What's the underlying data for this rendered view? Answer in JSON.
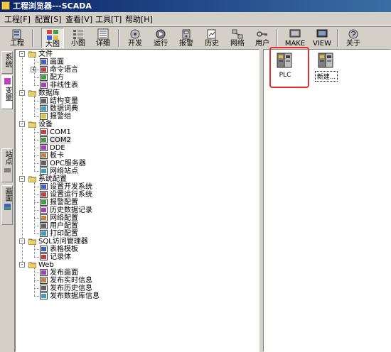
{
  "window": {
    "title": "工程浏览器---SCADA"
  },
  "menu": [
    "工程[F]",
    "配置[S]",
    "查看[V]",
    "工具[T]",
    "帮助[H]"
  ],
  "toolbar": {
    "buttons": [
      {
        "label": "工程",
        "icon": "project-icon"
      },
      {
        "label": "大图",
        "icon": "large-icons-icon",
        "pressed": true
      },
      {
        "label": "小图",
        "icon": "small-icons-icon"
      },
      {
        "label": "详细",
        "icon": "details-icon"
      },
      {
        "label": "开发",
        "icon": "develop-icon"
      },
      {
        "label": "运行",
        "icon": "run-icon"
      },
      {
        "label": "报警",
        "icon": "alarm-icon"
      },
      {
        "label": "历史",
        "icon": "history-icon"
      },
      {
        "label": "网络",
        "icon": "network-icon"
      },
      {
        "label": "用户",
        "icon": "user-key-icon"
      },
      {
        "label": "MAKE",
        "icon": "make-icon"
      },
      {
        "label": "VIEW",
        "icon": "view-icon"
      },
      {
        "label": "关于",
        "icon": "about-icon"
      }
    ]
  },
  "sidetabs": [
    "系统",
    "变量",
    "站点",
    "画面"
  ],
  "tree": [
    {
      "label": "文件",
      "level": 0,
      "icon": "folder-icon",
      "expander": "-"
    },
    {
      "label": "画面",
      "level": 1,
      "icon": "picture-icon"
    },
    {
      "label": "命令语言",
      "level": 1,
      "icon": "command-icon",
      "expander": "+"
    },
    {
      "label": "配方",
      "level": 1,
      "icon": "recipe-icon"
    },
    {
      "label": "非线性表",
      "level": 1,
      "icon": "table-icon"
    },
    {
      "label": "数据库",
      "level": 0,
      "icon": "database-icon",
      "expander": "-"
    },
    {
      "label": "结构变量",
      "level": 1,
      "icon": "struct-icon"
    },
    {
      "label": "数据词典",
      "level": 1,
      "icon": "dictionary-icon"
    },
    {
      "label": "报警组",
      "level": 1,
      "icon": "alarm-group-icon"
    },
    {
      "label": "设备",
      "level": 0,
      "icon": "device-icon",
      "expander": "-"
    },
    {
      "label": "COM1",
      "level": 1,
      "icon": "com-port-icon"
    },
    {
      "label": "COM2",
      "level": 1,
      "icon": "com-port-icon",
      "selected": true
    },
    {
      "label": "DDE",
      "level": 1,
      "icon": "dde-icon"
    },
    {
      "label": "板卡",
      "level": 1,
      "icon": "board-icon"
    },
    {
      "label": "OPC服务器",
      "level": 1,
      "icon": "opc-icon"
    },
    {
      "label": "网络站点",
      "level": 1,
      "icon": "network-node-icon"
    },
    {
      "label": "系统配置",
      "level": 0,
      "icon": "system-config-icon",
      "expander": "-"
    },
    {
      "label": "设置开发系统",
      "level": 1,
      "icon": "dev-settings-icon"
    },
    {
      "label": "设置运行系统",
      "level": 1,
      "icon": "run-settings-icon"
    },
    {
      "label": "报警配置",
      "level": 1,
      "icon": "alarm-config-icon"
    },
    {
      "label": "历史数据记录",
      "level": 1,
      "icon": "history-record-icon"
    },
    {
      "label": "网络配置",
      "level": 1,
      "icon": "network-config-icon"
    },
    {
      "label": "用户配置",
      "level": 1,
      "icon": "user-config-icon"
    },
    {
      "label": "打印配置",
      "level": 1,
      "icon": "print-icon"
    },
    {
      "label": "SQL访问管理器",
      "level": 0,
      "icon": "sql-icon",
      "expander": "-"
    },
    {
      "label": "表格模板",
      "level": 1,
      "icon": "template-icon"
    },
    {
      "label": "记录体",
      "level": 1,
      "icon": "record-icon"
    },
    {
      "label": "Web",
      "level": 0,
      "icon": "web-folder-icon",
      "expander": "-"
    },
    {
      "label": "发布画面",
      "level": 1,
      "icon": "publish-icon"
    },
    {
      "label": "发布实时信息",
      "level": 1,
      "icon": "publish-realtime-icon"
    },
    {
      "label": "发布历史信息",
      "level": 1,
      "icon": "publish-history-icon"
    },
    {
      "label": "发布数据库信息",
      "level": 1,
      "icon": "publish-db-icon"
    }
  ],
  "content_items": [
    {
      "label": "PLC",
      "icon": "plc-device-icon",
      "highlighted": true
    },
    {
      "label": "新建...",
      "icon": "new-device-icon",
      "selected": true
    }
  ]
}
